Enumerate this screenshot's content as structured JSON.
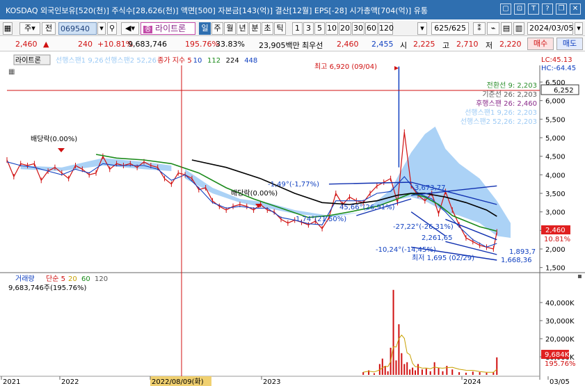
{
  "titlebar": {
    "text": "KOSDAQ  외국인보유[520(천)]  주식수[28,626(천)]  액면[500]  자본금[143(억)]  결산[12월]  EPS[-28]  시가총액[704(억)]  유통",
    "icons": [
      "window-icon",
      "link-icon",
      "text-icon",
      "help-icon",
      "restore-icon",
      "close-icon"
    ]
  },
  "toolbar": {
    "period_type": "주",
    "prev_label": "전",
    "code": "069540",
    "stock_name": "라이트론",
    "intervals": [
      "일",
      "주",
      "월",
      "년",
      "분",
      "초",
      "틱"
    ],
    "selected_interval": "일",
    "multipliers": [
      "1",
      "3",
      "5",
      "10",
      "20",
      "30",
      "60",
      "120"
    ],
    "count": "625/625",
    "date": "2024/03/05"
  },
  "quote": {
    "price": "2,460",
    "arrow": "▲",
    "change": "240",
    "change_pct": "+10.81%",
    "volume": "9,683,746",
    "vol_ratio": "195.76%",
    "turnover": "33.83%",
    "amount": "23,905백만",
    "best_label": "최우선",
    "best_ask": "2,460",
    "best_bid": "2,455",
    "open_label": "시",
    "open": "2,225",
    "high_label": "고",
    "high": "2,710",
    "low_label": "저",
    "low": "2,220",
    "buy_label": "매수",
    "sell_label": "매도"
  },
  "chart_data": [
    {
      "type": "line",
      "title": "라이트론",
      "legend": [
        {
          "name": "선행스팬1 9,26",
          "color": "#9ccaf5"
        },
        {
          "name": "선행스팬2 52,26",
          "color": "#9ccaf5"
        },
        {
          "name": "종가 지수 5",
          "color": "#d01010"
        },
        {
          "name": "10",
          "color": "#1040c0"
        },
        {
          "name": "112",
          "color": "#1a8a1a"
        },
        {
          "name": "224",
          "color": "#000000"
        },
        {
          "name": "448",
          "color": "#1040c0"
        }
      ],
      "x_labels": [
        "2021",
        "2022",
        "2022/08/09(화)",
        "2023",
        "2024",
        "03/05"
      ],
      "y_ticks": [
        1500,
        2000,
        2500,
        3000,
        3500,
        4000,
        4500,
        5000,
        5500,
        6000,
        6500
      ],
      "ylim": [
        1400,
        6800
      ],
      "right_top": {
        "lc": "LC:45.13",
        "hc": "HC:-64.45"
      },
      "crosshair_value": "6,252",
      "current_value": "2,460",
      "current_pct": "10.81%",
      "info": [
        {
          "text": "전환선 9: 2,203",
          "color": "#2d8f2d"
        },
        {
          "text": "기준선 26: 2,203",
          "color": "#555555"
        },
        {
          "text": "후행스팬 26: 2,460",
          "color": "#8a2a8a"
        },
        {
          "text": "선행스팬1 9,26: 2,203",
          "color": "#9ccaf5"
        },
        {
          "text": "선행스팬2 52,26: 2,203",
          "color": "#9ccaf5"
        }
      ],
      "annotations": [
        {
          "text": "최고 6,920 (09/04)",
          "color": "#d01010"
        },
        {
          "text": "배당락(0.00%)",
          "color": "#000000"
        },
        {
          "text": "배당락(0.00%)",
          "color": "#000000"
        },
        {
          "text": "-1,49°(-1,77%)",
          "color": "#1040c0"
        },
        {
          "text": "1,74°(21,50%)",
          "color": "#1040c0"
        },
        {
          "text": "45,66°(26,91%)",
          "color": "#1040c0"
        },
        {
          "text": "3,673,77",
          "color": "#1040c0"
        },
        {
          "text": "-27,22°(-26,31%)",
          "color": "#1040c0"
        },
        {
          "text": "2,261,65",
          "color": "#1040c0"
        },
        {
          "text": "-10,24°(-14,45%)",
          "color": "#1040c0"
        },
        {
          "text": "최저 1,695 (02/29)",
          "color": "#1040c0"
        },
        {
          "text": "1,893,7",
          "color": "#1040c0"
        },
        {
          "text": "1,668,36",
          "color": "#1040c0"
        }
      ],
      "series": [
        {
          "name": "종가 지수 5",
          "color": "#d01010",
          "x": [
            0,
            10,
            20,
            30,
            40,
            50,
            60,
            70,
            80,
            90,
            100,
            110,
            120,
            130,
            140,
            150,
            160,
            170,
            180,
            190,
            200,
            210,
            220,
            230,
            240,
            250,
            260,
            270,
            280,
            290,
            300,
            310,
            320,
            330,
            340,
            350,
            360,
            370,
            380,
            390,
            400,
            410,
            420,
            430,
            440,
            450,
            460,
            470,
            480,
            490,
            500,
            510,
            520,
            530,
            540,
            550,
            560,
            570,
            580,
            590,
            600,
            610,
            620,
            630,
            640,
            650,
            660,
            670,
            680,
            690,
            700,
            710,
            715
          ],
          "values": [
            4400,
            3950,
            4300,
            4250,
            4300,
            3850,
            4100,
            4200,
            4050,
            3900,
            4250,
            4150,
            4000,
            4050,
            4500,
            4150,
            4300,
            4250,
            4300,
            4200,
            4350,
            4250,
            4200,
            3900,
            3750,
            4050,
            4000,
            3900,
            3600,
            3650,
            3300,
            3150,
            3050,
            3150,
            3200,
            3150,
            3050,
            3200,
            3050,
            3000,
            2800,
            2700,
            2780,
            2720,
            2650,
            2750,
            2550,
            2850,
            3500,
            3200,
            3400,
            3300,
            3250,
            3500,
            3700,
            3800,
            3900,
            3250,
            5150,
            3700,
            3450,
            3300,
            3500,
            2950,
            3550,
            3050,
            2650,
            2300,
            2200,
            2100,
            2050,
            2000,
            2460
          ]
        },
        {
          "name": "10",
          "color": "#1040c0",
          "x": [
            0,
            20,
            40,
            60,
            80,
            100,
            120,
            140,
            160,
            180,
            200,
            220,
            240,
            260,
            280,
            300,
            320,
            340,
            360,
            380,
            400,
            420,
            440,
            460,
            480,
            500,
            520,
            540,
            560,
            580,
            600,
            620,
            640,
            660,
            680,
            700,
            715
          ],
          "values": [
            4350,
            4250,
            4200,
            4100,
            4000,
            4150,
            4050,
            4300,
            4250,
            4250,
            4250,
            4150,
            3850,
            4000,
            3650,
            3250,
            3100,
            3150,
            3100,
            3100,
            2850,
            2780,
            2680,
            2650,
            3300,
            3300,
            3300,
            3500,
            3550,
            3950,
            3500,
            3350,
            3000,
            2600,
            2250,
            2050,
            2150
          ]
        },
        {
          "name": "112",
          "color": "#1a8a1a",
          "x": [
            130,
            160,
            200,
            240,
            280,
            320,
            360,
            400,
            440,
            470,
            500,
            540,
            570,
            590,
            610,
            630,
            650,
            670,
            690,
            715
          ],
          "values": [
            4550,
            4450,
            4400,
            4300,
            4050,
            3650,
            3350,
            3100,
            2850,
            2900,
            3000,
            3150,
            3350,
            3500,
            3400,
            3200,
            2900,
            2750,
            2600,
            2480
          ]
        },
        {
          "name": "224",
          "color": "#000000",
          "x": [
            270,
            320,
            370,
            420,
            460,
            500,
            540,
            570,
            590,
            610,
            640,
            670,
            700,
            715
          ],
          "values": [
            4400,
            4200,
            3900,
            3500,
            3250,
            3200,
            3300,
            3450,
            3500,
            3500,
            3400,
            3250,
            3050,
            2880
          ]
        }
      ]
    },
    {
      "type": "bar",
      "title": "거래량",
      "legend": [
        {
          "name": "단순 5",
          "color": "#d01010"
        },
        {
          "name": "20",
          "color": "#c8a000"
        },
        {
          "name": "60",
          "color": "#1a8a1a"
        },
        {
          "name": "120",
          "color": "#555555"
        }
      ],
      "subtitle": "9,683,746주(195.76%)",
      "y_ticks": [
        "10,000K",
        "20,000K",
        "30,000K",
        "40,000K"
      ],
      "ylim": [
        0,
        50000
      ],
      "current_value": "9,684K",
      "current_pct": "195.76%",
      "x": [
        520,
        528,
        536,
        544,
        548,
        552,
        556,
        560,
        564,
        568,
        572,
        576,
        580,
        584,
        588,
        592,
        596,
        600,
        606,
        612,
        618,
        624,
        630,
        636,
        642,
        650,
        660,
        670,
        680,
        690,
        700,
        710,
        715
      ],
      "values": [
        1500,
        2500,
        900,
        6000,
        9000,
        5000,
        2000,
        15000,
        47000,
        8000,
        28000,
        12000,
        6000,
        7000,
        3000,
        4000,
        2500,
        6000,
        3000,
        3500,
        2000,
        7000,
        4000,
        2000,
        5000,
        3000,
        1500,
        1200,
        1800,
        1500,
        1200,
        1400,
        9684
      ]
    }
  ]
}
